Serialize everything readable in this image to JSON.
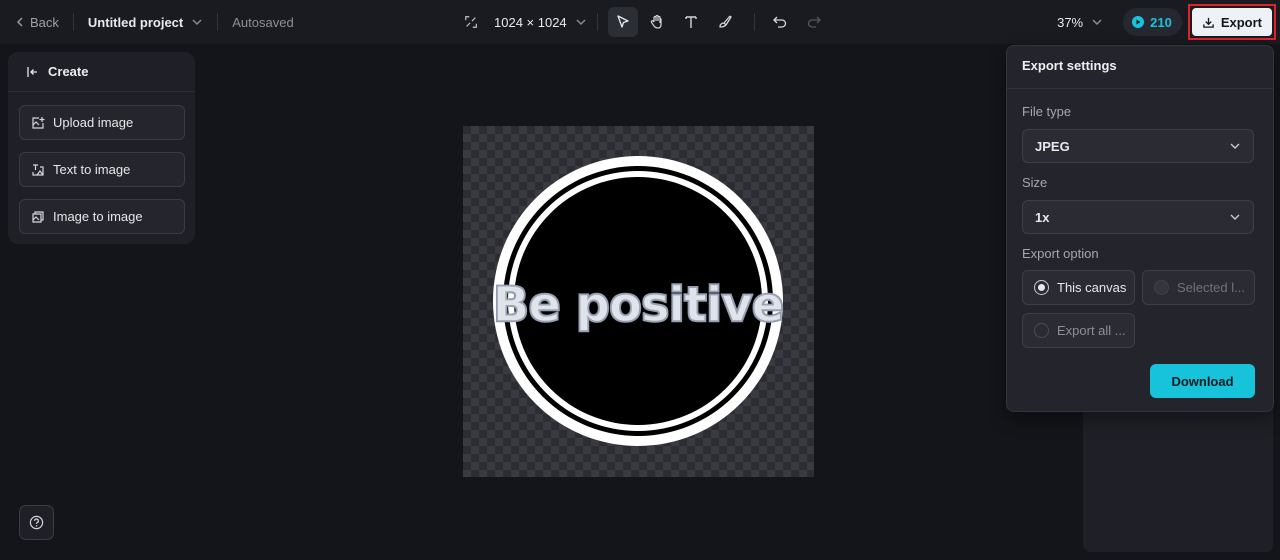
{
  "header": {
    "back_label": "Back",
    "project_name": "Untitled project",
    "save_status": "Autosaved",
    "canvas_size": "1024 × 1024",
    "zoom": "37%",
    "credits": "210",
    "export_label": "Export"
  },
  "tools": [
    "select-tool",
    "hand-tool",
    "text-tool",
    "brush-tool",
    "undo",
    "redo"
  ],
  "left_panel": {
    "title": "Create",
    "items": [
      {
        "label": "Upload image",
        "icon": "upload-image-icon"
      },
      {
        "label": "Text to image",
        "icon": "text-to-image-icon"
      },
      {
        "label": "Image to image",
        "icon": "image-to-image-icon"
      }
    ]
  },
  "canvas": {
    "artwork_text": "Be positive"
  },
  "export_panel": {
    "title": "Export settings",
    "file_type_label": "File type",
    "file_type_value": "JPEG",
    "size_label": "Size",
    "size_value": "1x",
    "export_option_label": "Export option",
    "options": [
      {
        "label": "This canvas",
        "selected": true,
        "disabled": false
      },
      {
        "label": "Selected l...",
        "selected": false,
        "disabled": true
      },
      {
        "label": "Export all ...",
        "selected": false,
        "disabled": false
      }
    ],
    "download_label": "Download"
  },
  "colors": {
    "accent": "#16c3db",
    "export_highlight": "#e0242c",
    "background": "#14151a"
  }
}
